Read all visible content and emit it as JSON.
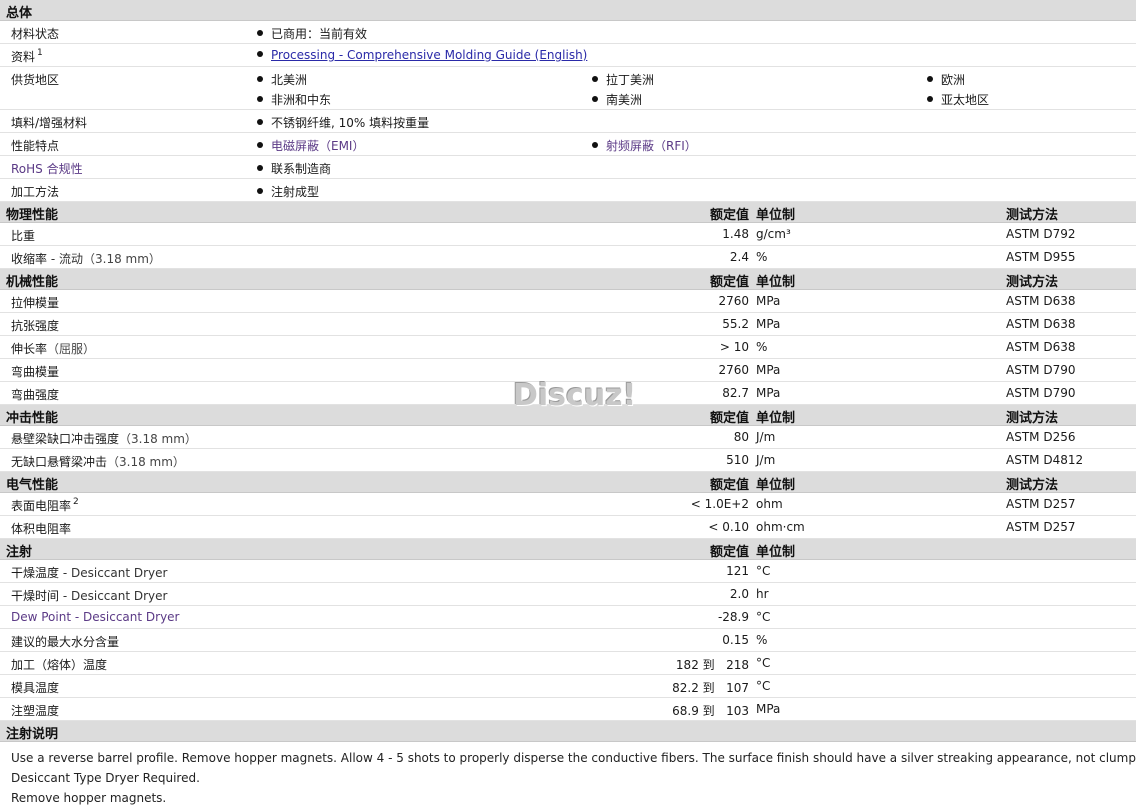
{
  "general": {
    "title": "总体",
    "status_label": "材料状态",
    "status_value": "已商用：当前有效",
    "docs_label": "资料",
    "docs_sup": "1",
    "docs_link": "Processing - Comprehensive Molding Guide (English)",
    "regions_label": "供货地区",
    "regions": [
      "北美洲",
      "拉丁美洲",
      "欧洲",
      "非洲和中东",
      "南美洲",
      "亚太地区"
    ],
    "filler_label": "填料/增强材料",
    "filler_value": "不锈钢纤维, 10% 填料按重量",
    "features_label": "性能特点",
    "features": [
      "电磁屏蔽（EMI）",
      "射频屏蔽（RFI）"
    ],
    "rohs_label": "RoHS 合规性",
    "rohs_value": "联系制造商",
    "process_label": "加工方法",
    "process_value": "注射成型"
  },
  "headers": {
    "value": "额定值",
    "unit": "单位制",
    "method": "测试方法"
  },
  "physical": {
    "title": "物理性能",
    "rows": [
      {
        "label": "比重",
        "value": "1.48",
        "unit": "g/cm³",
        "method": "ASTM D792"
      },
      {
        "label": "收缩率",
        "sub": "- 流动",
        "paren": "（3.18 mm）",
        "value": "2.4",
        "unit": "%",
        "method": "ASTM D955"
      }
    ]
  },
  "mechanical": {
    "title": "机械性能",
    "rows": [
      {
        "label": "拉伸模量",
        "value": "2760",
        "unit": "MPa",
        "method": "ASTM D638"
      },
      {
        "label": "抗张强度",
        "value": "55.2",
        "unit": "MPa",
        "method": "ASTM D638"
      },
      {
        "label": "伸长率",
        "paren": "（屈服）",
        "value": "> 10",
        "unit": "%",
        "method": "ASTM D638"
      },
      {
        "label": "弯曲模量",
        "value": "2760",
        "unit": "MPa",
        "method": "ASTM D790"
      },
      {
        "label": "弯曲强度",
        "value": "82.7",
        "unit": "MPa",
        "method": "ASTM D790"
      }
    ]
  },
  "impact": {
    "title": "冲击性能",
    "rows": [
      {
        "label": "悬壁梁缺口冲击强度",
        "paren": "（3.18 mm）",
        "value": "80",
        "unit": "J/m",
        "method": "ASTM D256"
      },
      {
        "label": "无缺口悬臂梁冲击",
        "paren": "（3.18 mm）",
        "value": "510",
        "unit": "J/m",
        "method": "ASTM D4812"
      }
    ]
  },
  "electrical": {
    "title": "电气性能",
    "rows": [
      {
        "label": "表面电阻率",
        "sup": "2",
        "value": "< 1.0E+2",
        "unit": "ohm",
        "method": "ASTM D257"
      },
      {
        "label": "体积电阻率",
        "value": "< 0.10",
        "unit": "ohm·cm",
        "method": "ASTM D257"
      }
    ]
  },
  "injection": {
    "title": "注射",
    "rows": [
      {
        "label": "干燥温度",
        "sub": "- Desiccant Dryer",
        "value": "121",
        "unit": "°C"
      },
      {
        "label": "干燥时间",
        "sub": "- Desiccant Dryer",
        "value": "2.0",
        "unit": "hr"
      },
      {
        "label": "Dew Point - Desiccant Dryer",
        "value": "-28.9",
        "unit": "°C"
      },
      {
        "label": "建议的最大水分含量",
        "value": "0.15",
        "unit": "%"
      },
      {
        "label": "加工（熔体）温度",
        "value": "182 到   218",
        "unit": "°C"
      },
      {
        "label": "模具温度",
        "value": "82.2 到   107",
        "unit": "°C"
      },
      {
        "label": "注塑温度",
        "value": "68.9 到   103",
        "unit": "MPa"
      }
    ]
  },
  "notes": {
    "title": "注射说明",
    "lines": [
      "Use a reverse barrel profile. Remove hopper magnets. Allow 4 - 5 shots to properly disperse the conductive fibers. The surface finish should have a silver streaking appearance, not clumps.",
      "Desiccant Type Dryer Required.",
      "Remove hopper magnets."
    ]
  },
  "watermark": "Discuz!"
}
